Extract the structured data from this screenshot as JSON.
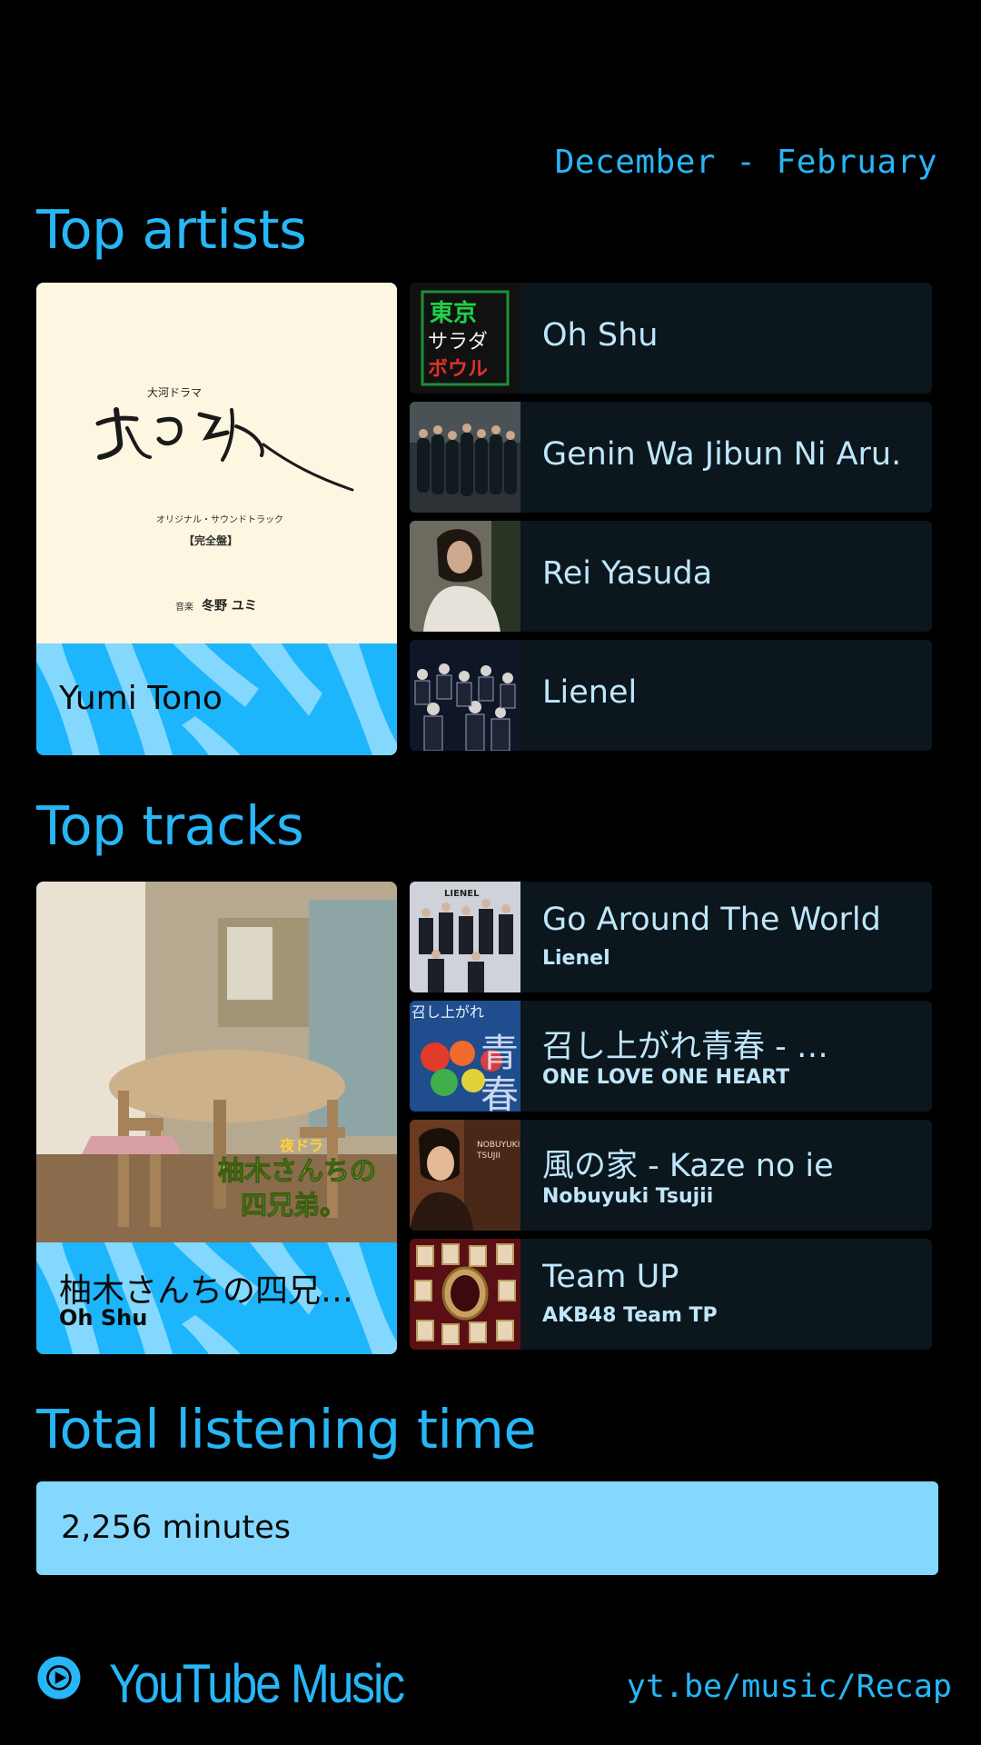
{
  "period": "December - February",
  "colors": {
    "accent": "#27b6f6",
    "band": "#1db5fb",
    "band_light": "#84d8fd",
    "card_bg": "#0b161d",
    "card_text": "#bfe6fb"
  },
  "top_artists": {
    "heading": "Top artists",
    "featured": {
      "name": "Yumi Tono",
      "cover_text": {
        "small_top": "大河ドラマ",
        "calligraphy": "光る君へ",
        "line1": "オリジナル・サウンドトラック",
        "line2": "【完全盤】",
        "credit_label": "音楽",
        "credit_name": "冬野 ユミ"
      }
    },
    "items": [
      {
        "name": "Oh Shu",
        "thumb": "tokyo-salad-bowl-cover",
        "thumb_text": [
          "東京",
          "サラダ",
          "ボウル"
        ]
      },
      {
        "name": "Genin Wa Jibun Ni Aru.",
        "thumb": "group-photo-dark"
      },
      {
        "name": "Rei Yasuda",
        "thumb": "portrait-photo"
      },
      {
        "name": "Lienel",
        "thumb": "group-photo-suits"
      }
    ]
  },
  "top_tracks": {
    "heading": "Top tracks",
    "featured": {
      "title": "柚木さんちの四兄…",
      "artist": "Oh Shu",
      "cover_text": {
        "tag": "夜ドラ",
        "line1": "柚木さんちの",
        "line2": "四兄弟。"
      }
    },
    "items": [
      {
        "title": "Go Around The World",
        "artist": "Lienel",
        "thumb": "lienel-group-cover",
        "thumb_text": "LIENEL"
      },
      {
        "title": "召し上がれ青春 - …",
        "artist": "ONE LOVE ONE HEART",
        "thumb": "billiard-balls-cover",
        "thumb_text": [
          "召し上がれ",
          "青",
          "春"
        ]
      },
      {
        "title": "風の家 - Kaze no ie",
        "artist": "Nobuyuki Tsujii",
        "thumb": "pianist-cover",
        "thumb_text": [
          "NOBUYUKI",
          "TSUJII"
        ]
      },
      {
        "title": "Team UP",
        "artist": "AKB48 Team TP",
        "thumb": "frames-collage-cover"
      }
    ]
  },
  "total": {
    "heading": "Total listening time",
    "value": "2,256 minutes"
  },
  "footer": {
    "brand": "YouTube Music",
    "url": "yt.be/music/Recap"
  }
}
